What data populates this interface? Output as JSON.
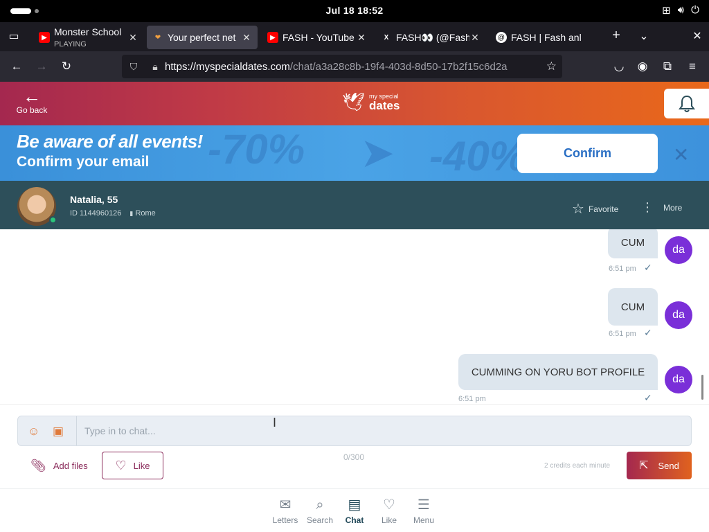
{
  "system": {
    "clock": "Jul 18  18:52"
  },
  "tabs": [
    {
      "title": "Monster School",
      "subtitle": "PLAYING",
      "active": false
    },
    {
      "title": "Your perfect net",
      "active": true
    },
    {
      "title": "FASH - YouTube",
      "active": false
    },
    {
      "title": "FASH👀 (@Fash",
      "active": false
    },
    {
      "title": "FASH | Fash anl",
      "active": false
    }
  ],
  "url": {
    "host": "https://myspecialdates.com",
    "path": "/chat/a3a28c8b-19f4-403d-8d50-17b2f15c6d2a"
  },
  "header": {
    "back_label": "Go back",
    "logo_small": "my special",
    "logo_big": "dates"
  },
  "banner": {
    "headline": "Be aware of all events!",
    "subline": "Confirm your email",
    "confirm_label": "Confirm",
    "deco1": "-70%",
    "deco2": "-40%"
  },
  "profile": {
    "name": "Natalia, 55",
    "id": "ID 1144960126",
    "city": "Rome",
    "favorite_label": "Favorite",
    "more_label": "More"
  },
  "messages": [
    {
      "text": "CUM",
      "time": "6:51 pm",
      "avatar": "da"
    },
    {
      "text": "CUM",
      "time": "6:51 pm",
      "avatar": "da"
    },
    {
      "text": "CUMMING ON YORU BOT PROFILE",
      "time": "6:51 pm",
      "avatar": "da"
    }
  ],
  "composer": {
    "placeholder": "Type in to chat...",
    "add_files_label": "Add files",
    "like_label": "Like",
    "counter": "0/300",
    "credits_note": "2 credits each minute",
    "send_label": "Send"
  },
  "bottom_nav": [
    {
      "label": "Letters",
      "icon": "envelope-icon",
      "active": false
    },
    {
      "label": "Search",
      "icon": "search-icon",
      "active": false
    },
    {
      "label": "Chat",
      "icon": "chat-icon",
      "active": true
    },
    {
      "label": "Like",
      "icon": "heart-icon",
      "active": false
    },
    {
      "label": "Menu",
      "icon": "menu-icon",
      "active": false
    }
  ]
}
